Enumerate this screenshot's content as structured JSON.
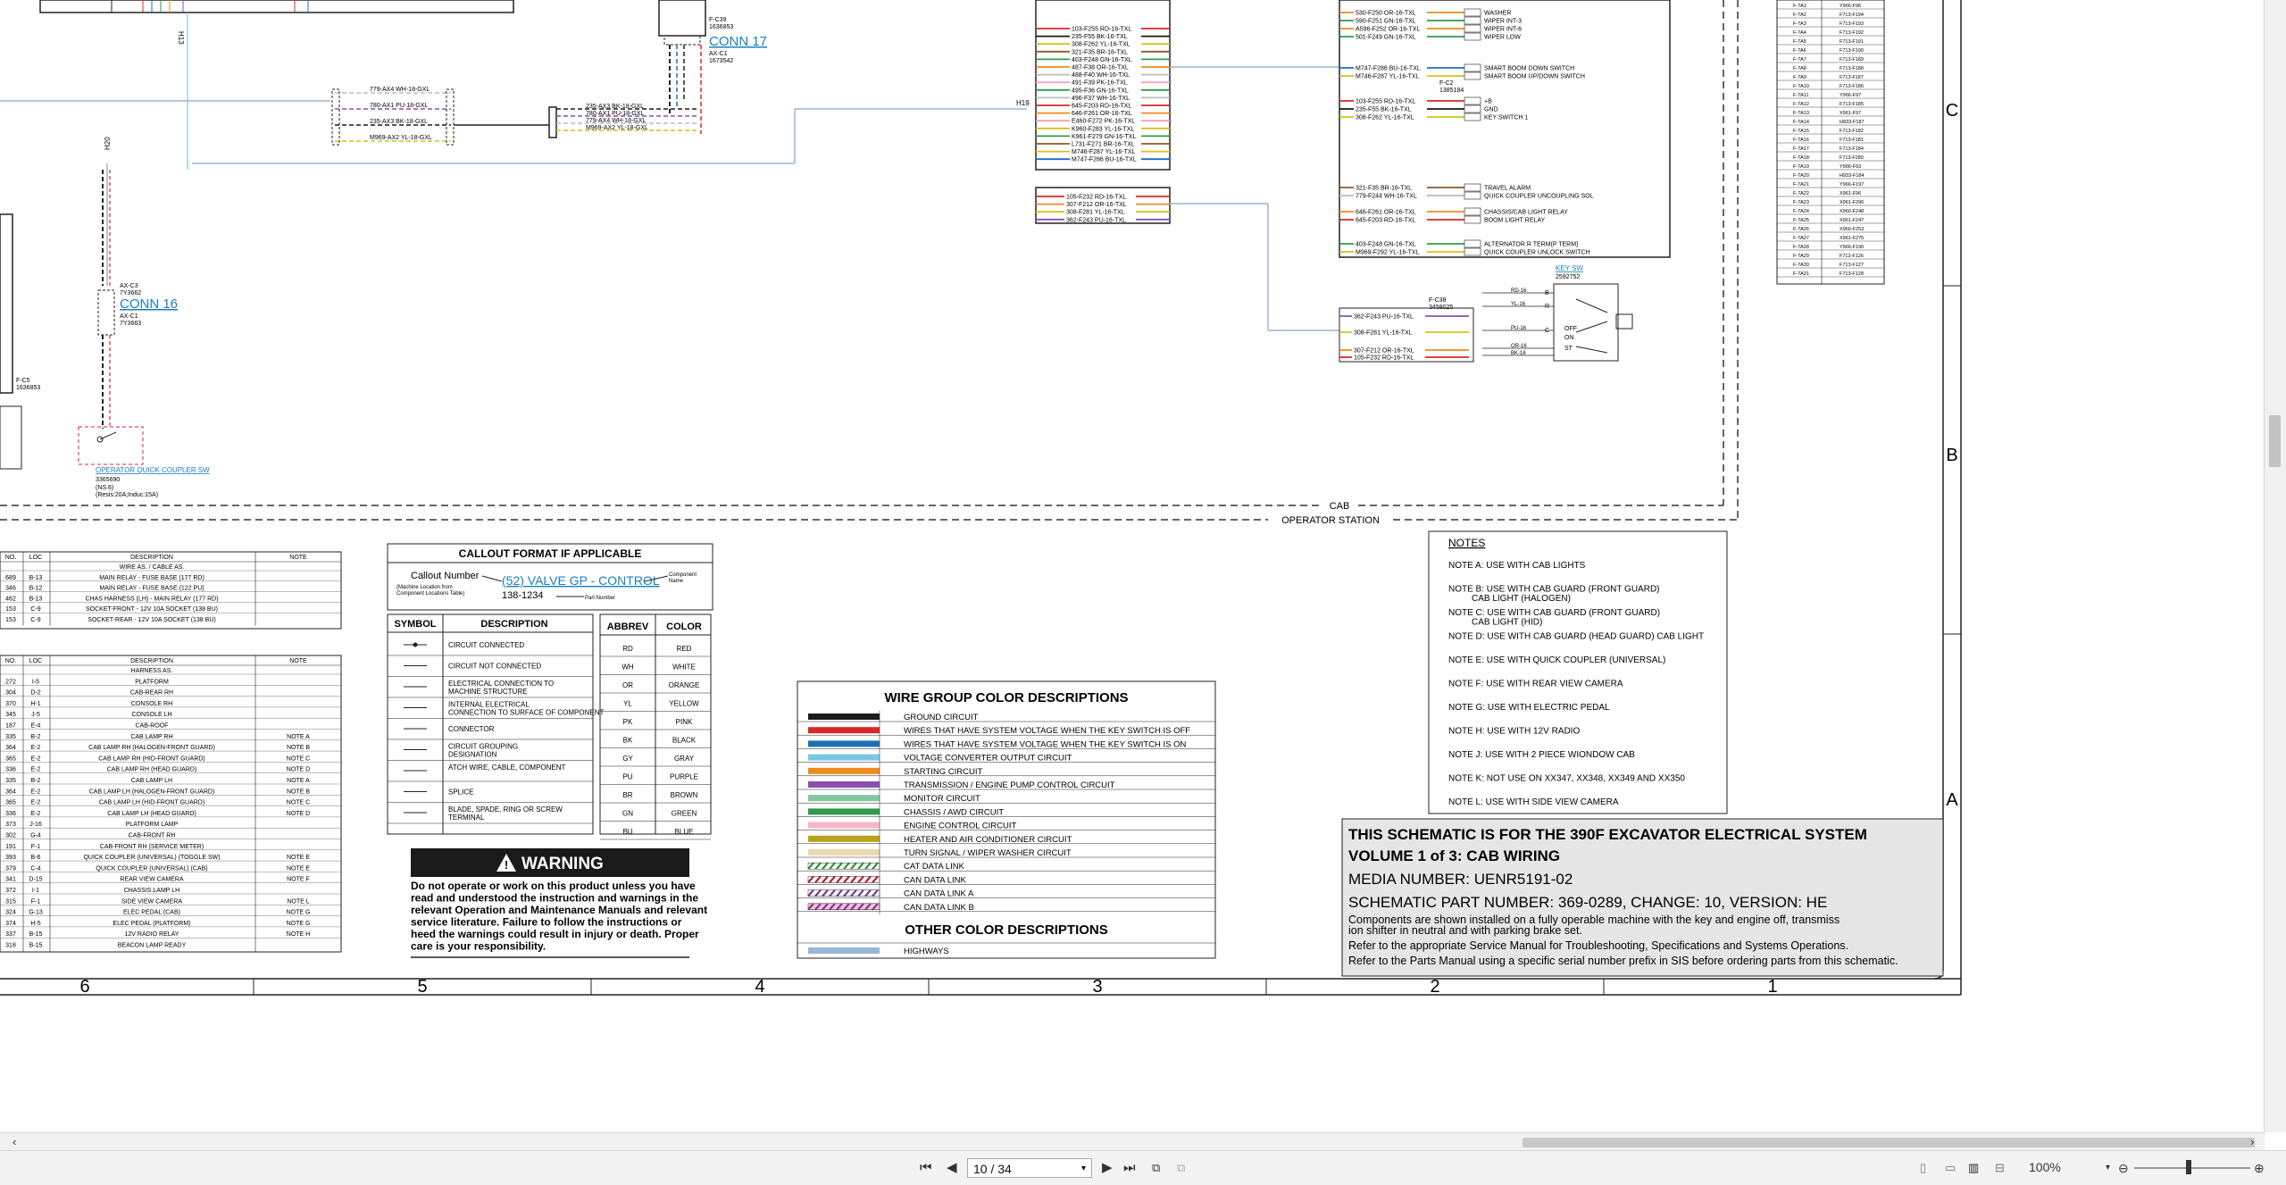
{
  "conn17": {
    "label": "CONN 17",
    "part": "AX-C1\n1673542",
    "fc": "F-C39\n1636853"
  },
  "conn16": {
    "label": "CONN 16",
    "c3": "AX-C3\n7Y3662",
    "c1": "AX-C1\n7Y3663"
  },
  "fc5": "F-C5\n1636853",
  "harness_left_wires": [
    "779-AX4 WH-18-GXL",
    "780-AX1 PU-18-GXL",
    "235-AX3 BK-18-GXL",
    "M969-AX2 YL-18-GXL"
  ],
  "conn17_wires": [
    "235-AX3 BK-18-GXL",
    "780-AX1 PU-18-GXL",
    "779-AX4 WH-18-GXL",
    "M969-AX2 YL-18-GXL"
  ],
  "h19": "H19",
  "h13": "H13",
  "h20": "H20",
  "qc_switch": {
    "label": "OPERATOR QUICK COUPLER SW",
    "num": "3365690",
    "note": "(NS.6)\n(Resis:20A;Induc:15A)"
  },
  "center_wires_a": [
    "103-F255 RD-16-TXL",
    "235-F55 BK-16-TXL",
    "308-F262 YL-16-TXL",
    "321-F35 BR-16-TXL",
    "403-F248 GN-16-TXL",
    "487-F38 OR-16-TXL",
    "488-F40 WH-16-TXL",
    "491-F39 PK-16-TXL",
    "495-F36 GN-16-TXL",
    "496-F37 WH-16-TXL",
    "645-F203 RD-16-TXL",
    "646-F261 OR-16-TXL",
    "E460-F272 PK-16-TXL",
    "K960-F283 YL-16-TXL",
    "K961-F279 GN-16-TXL",
    "L731-F271 BR-16-TXL",
    "M746-F287 YL-16-TXL",
    "M747-F286 BU-16-TXL"
  ],
  "center_wires_b": [
    "105-F232 RD-16-TXL",
    "307-F212 OR-16-TXL",
    "308-F281 YL-16-TXL",
    "362-F243 PU-16-TXL"
  ],
  "right_wires_a": [
    "530-F250 OR-16-TXL",
    "590-F251 GN-16-TXL",
    "A596-F252 OR-16-TXL",
    "501-F249 GN-16-TXL"
  ],
  "right_desc_a": [
    "WASHER",
    "WIPER INT-3",
    "WIPER INT-6",
    "WIPER LOW"
  ],
  "right_wires_b": [
    "M747-F286 BU-16-TXL",
    "M746-F287 YL-16-TXL"
  ],
  "right_desc_b": [
    "SMART BOOM DOWN SWITCH",
    "SMART BOOM UP/DOWN SWITCH"
  ],
  "fc2": "F-C2\n1385184",
  "right_wires_c": [
    "103-F255 RD-16-TXL",
    "235-F55 BK-16-TXL",
    "308-F262 YL-16-TXL"
  ],
  "right_desc_c": [
    "+B",
    "GND",
    "KEY SWITCH 1"
  ],
  "right_wires_d": [
    "321-F35 BR-16-TXL",
    "779-F244 WH-16-TXL",
    "646-F261 OR-16-TXL",
    "645-F203 RD-16-TXL",
    "403-F248 GN-16-TXL",
    "M969-F292 YL-16-TXL"
  ],
  "right_desc_d": [
    "TRAVEL ALARM",
    "QUICK COUPLER UNCOUPLING SOL",
    "CHASSIS/CAB LIGHT RELAY",
    "BOOM LIGHT RELAY",
    "ALTERNATOR R TERM(P TERM)",
    "QUICK COUPLER UNLOCK SWITCH"
  ],
  "key_sw": {
    "label": "KEY SW",
    "num": "2592752",
    "fc": "F-C38\n3458025"
  },
  "key_wires": [
    "362-F243 PU-16-TXL",
    "308-F281 YL-16-TXL",
    "307-F212 OR-16-TXL",
    "105-F232 RD-16-TXL"
  ],
  "key_pins": [
    "RD-16",
    "YL-16",
    "PU-16",
    "OR-16",
    "BK-16"
  ],
  "key_letters": [
    "B",
    "R",
    "C",
    "OFF",
    "ON",
    "ST"
  ],
  "cab_label": "CAB",
  "operator_station_label": "OPERATOR STATION",
  "zone_letters": [
    "C",
    "B",
    "A"
  ],
  "zone_numbers": [
    "6",
    "5",
    "4",
    "3",
    "2",
    "1"
  ],
  "loc_table_top": {
    "headers": [
      "NO.",
      "LOC",
      "DESCRIPTION",
      "NOTE"
    ],
    "section": "WIRE AS. / CABLE AS.",
    "rows": [
      [
        "689",
        "B-13",
        "MAIN RELAY - FUSE BASE (177 RD)",
        ""
      ],
      [
        "346",
        "B-12",
        "MAIN RELAY - FUSE BASE (122 PU)",
        ""
      ],
      [
        "462",
        "B-13",
        "CHAS HARNESS (LH) - MAIN RELAY (177 RD)",
        ""
      ],
      [
        "153",
        "C-9",
        "SOCKET-FRONT - 12V 10A SOCKET (138 BU)",
        ""
      ],
      [
        "153",
        "C-9",
        "SOCKET-REAR - 12V 10A SOCKET (138 BU)",
        ""
      ]
    ]
  },
  "loc_table_bottom": {
    "headers": [
      "NO.",
      "LOC",
      "DESCRIPTION",
      "NOTE"
    ],
    "section": "HARNESS AS.",
    "rows": [
      [
        "272",
        "I-5",
        "PLATFORM",
        ""
      ],
      [
        "304",
        "D-2",
        "CAB-REAR RH",
        ""
      ],
      [
        "370",
        "H-1",
        "CONSOLE RH",
        ""
      ],
      [
        "345",
        "J-5",
        "CONSOLE LH",
        ""
      ],
      [
        "187",
        "E-4",
        "CAB-ROOF",
        ""
      ],
      [
        "335",
        "B-2",
        "CAB LAMP RH",
        "NOTE A"
      ],
      [
        "364",
        "E-2",
        "CAB LAMP RH (HALOGEN-FRONT GUARD)",
        "NOTE B"
      ],
      [
        "365",
        "E-2",
        "CAB LAMP RH (HID-FRONT GUARD)",
        "NOTE C"
      ],
      [
        "336",
        "E-2",
        "CAB LAMP RH (HEAD GUARD)",
        "NOTE D"
      ],
      [
        "335",
        "B-2",
        "CAB LAMP LH",
        "NOTE A"
      ],
      [
        "364",
        "E-2",
        "CAB LAMP LH (HALOGEN-FRONT GUARD)",
        "NOTE B"
      ],
      [
        "365",
        "E-2",
        "CAB LAMP LH (HID-FRONT GUARD)",
        "NOTE C"
      ],
      [
        "336",
        "E-2",
        "CAB LAMP LH (HEAD GUARD)",
        "NOTE D"
      ],
      [
        "373",
        "J-16",
        "PLATFORM LAMP",
        ""
      ],
      [
        "302",
        "G-4",
        "CAB-FRONT RH",
        ""
      ],
      [
        "191",
        "F-1",
        "CAB-FRONT RH (SERVICE METER)",
        ""
      ],
      [
        "393",
        "B-6",
        "QUICK COUPLER (UNIVERSAL) (TOGGLE SW)",
        "NOTE E"
      ],
      [
        "379",
        "C-4",
        "QUICK COUPLER (UNIVERSAL) (CAB)",
        "NOTE E"
      ],
      [
        "341",
        "D-15",
        "REAR VIEW CAMERA",
        "NOTE F"
      ],
      [
        "372",
        "I-1",
        "CHASSIS LAMP LH",
        ""
      ],
      [
        "315",
        "F-1",
        "SIDE VIEW CAMERA",
        "NOTE L"
      ],
      [
        "324",
        "G-13",
        "ELEC PEDAL (CAB)",
        "NOTE G"
      ],
      [
        "374",
        "H-5",
        "ELEC PEDAL (PLATFORM)",
        "NOTE G"
      ],
      [
        "337",
        "B-15",
        "12V RADIO RELAY",
        "NOTE H"
      ],
      [
        "318",
        "B-15",
        "BEACON LAMP READY",
        ""
      ]
    ]
  },
  "callout": {
    "title": "CALLOUT FORMAT IF APPLICABLE",
    "callout_number": "Callout Number",
    "machine_location": "(Machine Location from\nComponent Locations Table)",
    "component": "(52) VALVE GP - CONTROL",
    "component_name": "Component\nName",
    "part": "138-1234",
    "part_number": "Part Number"
  },
  "symbols": {
    "headers": [
      "SYMBOL",
      "DESCRIPTION"
    ],
    "rows": [
      "CIRCUIT CONNECTED",
      "CIRCUIT NOT CONNECTED",
      "ELECTRICAL CONNECTION TO MACHINE STRUCTURE",
      "INTERNAL ELECTRICAL CONNECTION TO SURFACE OF COMPONENT",
      "CONNECTOR",
      "CIRCUIT GROUPING DESIGNATION",
      "ATCH WIRE, CABLE, COMPONENT",
      "SPLICE",
      "BLADE, SPADE, RING OR SCREW TERMINAL"
    ]
  },
  "abbrev": {
    "headers": [
      "ABBREV",
      "COLOR"
    ],
    "rows": [
      [
        "RD",
        "RED"
      ],
      [
        "WH",
        "WHITE"
      ],
      [
        "OR",
        "ORANGE"
      ],
      [
        "YL",
        "YELLOW"
      ],
      [
        "PK",
        "PINK"
      ],
      [
        "BK",
        "BLACK"
      ],
      [
        "GY",
        "GRAY"
      ],
      [
        "PU",
        "PURPLE"
      ],
      [
        "BR",
        "BROWN"
      ],
      [
        "GN",
        "GREEN"
      ],
      [
        "BU",
        "BLUE"
      ]
    ]
  },
  "warning": {
    "title": "WARNING",
    "text": "Do not operate or work on this product unless you have read and understood the instruction and warnings in the relevant Operation and Maintenance Manuals and relevant service literature. Failure to follow the instructions or heed the warnings could result in injury or death. Proper care is your responsibility."
  },
  "wire_groups": {
    "title": "WIRE GROUP COLOR DESCRIPTIONS",
    "rows": [
      {
        "label": "GROUND CIRCUIT",
        "color": "#1a1a1a",
        "style": "solid"
      },
      {
        "label": "WIRES THAT HAVE SYSTEM VOLTAGE WHEN THE KEY SWITCH IS OFF",
        "color": "#d62828",
        "style": "solid"
      },
      {
        "label": "WIRES THAT HAVE SYSTEM VOLTAGE WHEN THE KEY SWITCH IS ON",
        "color": "#1f6fb8",
        "style": "solid"
      },
      {
        "label": "VOLTAGE CONVERTER OUTPUT CIRCUIT",
        "color": "#79c7e6",
        "style": "solid"
      },
      {
        "label": "STARTING CIRCUIT",
        "color": "#f08a1c",
        "style": "solid"
      },
      {
        "label": "TRANSMISSION / ENGINE PUMP CONTROL CIRCUIT",
        "color": "#8b4fb0",
        "style": "solid"
      },
      {
        "label": "MONITOR CIRCUIT",
        "color": "#7fc8a0",
        "style": "solid"
      },
      {
        "label": "CHASSIS / AWD CIRCUIT",
        "color": "#2e9a4a",
        "style": "solid"
      },
      {
        "label": "ENGINE CONTROL CIRCUIT",
        "color": "#f5b7c8",
        "style": "solid"
      },
      {
        "label": "HEATER AND AIR CONDITIONER CIRCUIT",
        "color": "#b8a21a",
        "style": "solid"
      },
      {
        "label": "TURN SIGNAL / WIPER WASHER CIRCUIT",
        "color": "#e8d9b0",
        "style": "solid"
      },
      {
        "label": "CAT DATA LINK",
        "color": "#2e8a3a",
        "style": "hatch"
      },
      {
        "label": "CAN DATA LINK",
        "color": "#b0203a",
        "style": "hatch"
      },
      {
        "label": "CAN DATA LINK A",
        "color": "#7a3a8a",
        "style": "hatch"
      },
      {
        "label": "CAN DATA LINK B",
        "color": "#7a3a8a",
        "style": "hatch2"
      }
    ],
    "other_title": "OTHER COLOR DESCRIPTIONS",
    "other_rows": [
      {
        "label": "HIGHWAYS",
        "color": "#9ab6d6"
      }
    ]
  },
  "notes": {
    "title": "NOTES",
    "rows": [
      "NOTE A: USE WITH CAB LIGHTS",
      "NOTE B: USE WITH CAB GUARD (FRONT GUARD)\n       CAB LIGHT (HALOGEN)",
      "NOTE C: USE WITH CAB GUARD (FRONT GUARD)\n       CAB LIGHT (HID)",
      "NOTE D: USE WITH CAB GUARD (HEAD GUARD) CAB LIGHT",
      "NOTE E: USE WITH QUICK COUPLER (UNIVERSAL)",
      "NOTE F: USE WITH REAR VIEW CAMERA",
      "NOTE G: USE WITH ELECTRIC PEDAL",
      "NOTE H: USE WITH 12V RADIO",
      "NOTE J: USE WITH 2 PIECE WIONDOW CAB",
      "NOTE K: NOT USE ON XX347, XX348, XX349 AND XX350",
      "NOTE L: USE WITH SIDE VIEW CAMERA"
    ]
  },
  "title_block": {
    "line1": "THIS SCHEMATIC IS FOR THE 390F EXCAVATOR ELECTRICAL SYSTEM",
    "line2": "VOLUME 1 of 3: CAB WIRING",
    "line3": "MEDIA NUMBER: UENR5191-02",
    "line4": "SCHEMATIC PART NUMBER: 369-0289, CHANGE: 10, VERSION: HE",
    "line5": "Components are shown installed on a fully operable machine with the key and engine off, transmission shifter in neutral and with parking brake set.",
    "line6": "Refer to the appropriate Service Manual for Troubleshooting, Specifications and Systems Operations.",
    "line7": "Refer to the Parts Manual using a specific serial number prefix in SIS before ordering parts from this schematic."
  },
  "fuse_table_rows": [
    "F-TA1",
    "F-TA2",
    "F-TA3",
    "F-TA4",
    "F-TA5",
    "F-TA6",
    "F-TA7",
    "F-TA8",
    "F-TA9",
    "F-TA10",
    "F-TA11",
    "F-TA12",
    "F-TA13",
    "F-TA14",
    "F-TA15",
    "F-TA16",
    "F-TA17",
    "F-TA18",
    "F-TA19",
    "F-TA20",
    "F-TA21",
    "F-TA22",
    "F-TA23",
    "F-TA24",
    "F-TA25",
    "F-TA26",
    "F-TA27",
    "F-TA28",
    "F-TA29",
    "F-TA30",
    "F-TA31"
  ],
  "fuse_table_vals": [
    "Y966-F96",
    "F713-F194",
    "F713-F193",
    "F713-F192",
    "F713-F191",
    "F713-F190",
    "F713-F189",
    "F713-F188",
    "F713-F187",
    "F713-F186",
    "Y966-F97",
    "F713-F185",
    "X961-F97",
    "H933-F187",
    "F713-F182",
    "F713-F181",
    "F713-F184",
    "F713-F280",
    "Y966-F93",
    "H933-F184",
    "Y966-F197",
    "X961-F96",
    "X961-F296",
    "X960-F248",
    "X961-F247",
    "X960-F253",
    "X961-F275",
    "Y966-F190",
    "F712-F126",
    "F713-F127",
    "F713-F128"
  ],
  "toolbar": {
    "page": "10 / 34",
    "zoom": "100%"
  }
}
